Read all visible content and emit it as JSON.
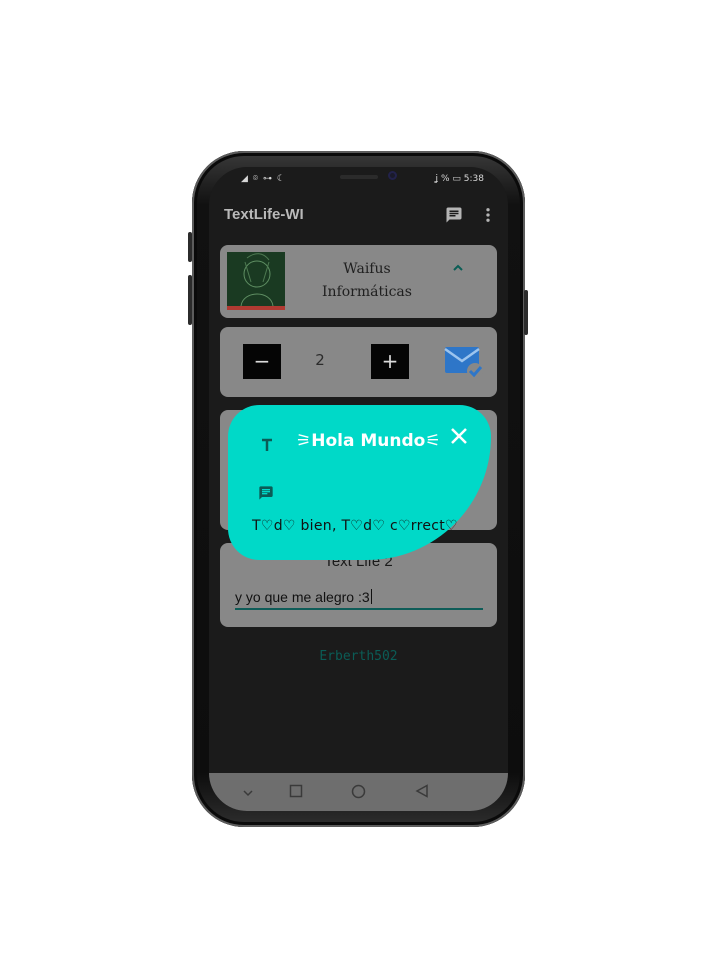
{
  "status_bar": {
    "left_icons": "◢ ⌾ ⊶ ☾",
    "battery_text": "ʝ % ▭ 5:38"
  },
  "app_bar": {
    "title": "TextLife-WI",
    "icons": [
      "chat-icon",
      "more-vert-icon"
    ]
  },
  "profile_card": {
    "name": "Waifus Informáticas",
    "expanded_icon": "chevron-up-icon"
  },
  "stepper": {
    "minus_label": "−",
    "plus_label": "+",
    "value": "2",
    "send_icon": "mail-check-icon"
  },
  "text_card": {
    "title": "Text Life 2",
    "input_value": "y yo que me alegro :3"
  },
  "footer": {
    "author": "Erberth502"
  },
  "toast": {
    "title": "⚞Hola Mundo⚟",
    "message": "T♡d♡ bien, T♡d♡ c♡rrect♡",
    "icons": [
      "title-icon",
      "message-icon",
      "close-icon"
    ]
  },
  "colors": {
    "accent": "#00d9c8",
    "dark_teal": "#0b5c56",
    "card_bg": "#888888",
    "screen_bg": "#1b1b1b",
    "mail_blue": "#2e76c8"
  }
}
